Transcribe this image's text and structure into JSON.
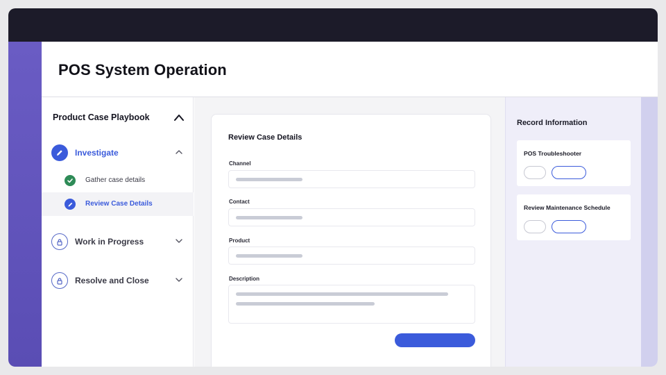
{
  "page": {
    "title": "POS System Operation"
  },
  "playbook": {
    "title": "Product Case Playbook",
    "steps": [
      {
        "label": "Investigate",
        "state": "active",
        "icon": "pencil-icon"
      },
      {
        "label": "Work in Progress",
        "state": "locked",
        "icon": "lock-icon"
      },
      {
        "label": "Resolve and Close",
        "state": "locked",
        "icon": "lock-icon"
      }
    ],
    "substeps": [
      {
        "label": "Gather case details",
        "state": "done",
        "icon": "check-icon"
      },
      {
        "label": "Review Case Details",
        "state": "current",
        "icon": "pencil-icon"
      }
    ]
  },
  "form": {
    "title": "Review Case Details",
    "fields": [
      {
        "label": "Channel"
      },
      {
        "label": "Contact"
      },
      {
        "label": "Product"
      },
      {
        "label": "Description"
      }
    ]
  },
  "record": {
    "title": "Record Information",
    "cards": [
      {
        "title": "POS Troubleshooter"
      },
      {
        "title": "Review Maintenance Schedule"
      }
    ]
  },
  "colors": {
    "accent": "#3b5bdb",
    "success": "#2e8b57",
    "topbar": "#1c1b29",
    "sidebar_strip": "#6a5cc4",
    "record_panel": "#efeef9"
  }
}
